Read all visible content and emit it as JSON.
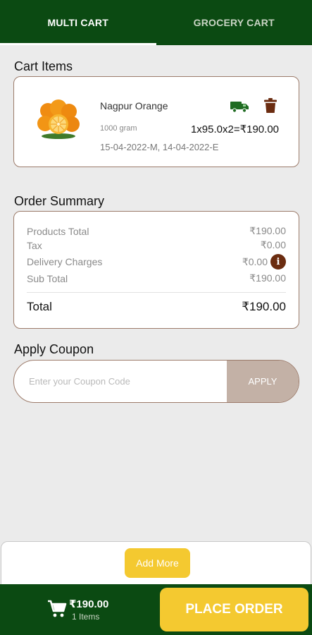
{
  "tabs": [
    {
      "label": "MULTI CART",
      "active": true
    },
    {
      "label": "GROCERY CART",
      "active": false
    }
  ],
  "cart": {
    "title": "Cart Items",
    "item": {
      "name": "Nagpur Orange",
      "weight": "1000 gram",
      "calc": "1x95.0x2=₹190.00",
      "dates": "15-04-2022-M, 14-04-2022-E"
    }
  },
  "summary": {
    "title": "Order Summary",
    "rows": [
      {
        "label": "Products Total",
        "value": "₹190.00"
      },
      {
        "label": "Tax",
        "value": "₹0.00"
      },
      {
        "label": "Delivery Charges",
        "value": "₹0.00"
      },
      {
        "label": "Sub Total",
        "value": "₹190.00"
      }
    ],
    "total_label": "Total",
    "total_value": "₹190.00"
  },
  "coupon": {
    "title": "Apply Coupon",
    "placeholder": "Enter your Coupon Code",
    "value": "",
    "apply_label": "APPLY"
  },
  "add_more_label": "Add More",
  "bottom": {
    "amount": "₹190.00",
    "items": "1 Items",
    "place_order_label": "PLACE ORDER"
  },
  "colors": {
    "header_green": "#0b4a12",
    "accent_yellow": "#f4c930",
    "brown": "#6b2c10",
    "apply_bg": "#c3b1a6"
  }
}
